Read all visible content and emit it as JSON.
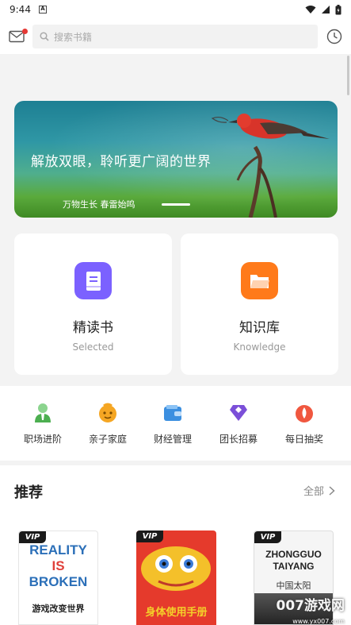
{
  "status_bar": {
    "time": "9:44"
  },
  "header": {
    "search_placeholder": "搜索书籍"
  },
  "banner": {
    "title": "解放双眼，聆听更广阔的世界",
    "subtitle": "万物生长 春雷始鸣"
  },
  "cards": [
    {
      "title": "精读书",
      "subtitle": "Selected",
      "icon": "book-icon",
      "color": "#7b61ff"
    },
    {
      "title": "知识库",
      "subtitle": "Knowledge",
      "icon": "folder-icon",
      "color": "#ff7a1a"
    }
  ],
  "categories": [
    {
      "label": "职场进阶",
      "icon": "career-icon",
      "color": "#4caf50"
    },
    {
      "label": "亲子家庭",
      "icon": "child-icon",
      "color": "#f5a623"
    },
    {
      "label": "财经管理",
      "icon": "wallet-icon",
      "color": "#3b8fe0"
    },
    {
      "label": "团长招募",
      "icon": "diamond-icon",
      "color": "#7b4fd8"
    },
    {
      "label": "每日抽奖",
      "icon": "drop-icon",
      "color": "#f0573f"
    }
  ],
  "recommend": {
    "title": "推荐",
    "all_label": "全部",
    "books": [
      {
        "vip": "VIP",
        "cover_title_en": [
          "REALITY",
          "IS",
          "BROKEN"
        ],
        "cover_title_cn": "游戏改变世界"
      },
      {
        "vip": "VIP",
        "cover_title_cn": "身体使用手册"
      },
      {
        "vip": "VIP",
        "cover_title_en": [
          "ZHONGGUO",
          "TAIYANG"
        ],
        "cover_title_cn": "中国太阳"
      }
    ]
  },
  "watermark": {
    "text": "007游戏网",
    "url": "www.yx007.com"
  }
}
